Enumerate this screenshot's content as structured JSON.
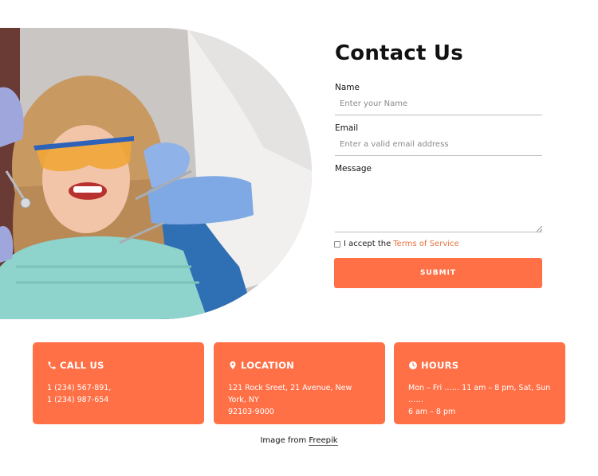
{
  "hero": {
    "image_alt": "dental-patient-photo"
  },
  "form": {
    "title": "Contact Us",
    "name_label": "Name",
    "name_placeholder": "Enter your Name",
    "email_label": "Email",
    "email_placeholder": "Enter a valid email address",
    "message_label": "Message",
    "terms_prefix": "I accept the",
    "terms_link": "Terms of Service",
    "submit_label": "SUBMIT",
    "accent_color": "#ff7047"
  },
  "cards": [
    {
      "icon": "phone-icon",
      "title": "CALL US",
      "lines": [
        "1 (234) 567-891,",
        "1 (234) 987-654"
      ]
    },
    {
      "icon": "location-pin-icon",
      "title": "LOCATION",
      "lines": [
        "121 Rock Sreet, 21 Avenue, New York, NY",
        "92103-9000"
      ]
    },
    {
      "icon": "clock-icon",
      "title": "HOURS",
      "lines": [
        "Mon – Fri …… 11 am – 8 pm, Sat, Sun ……",
        "6 am – 8 pm"
      ]
    }
  ],
  "credit": {
    "prefix": "Image from",
    "link": "Freepik"
  }
}
